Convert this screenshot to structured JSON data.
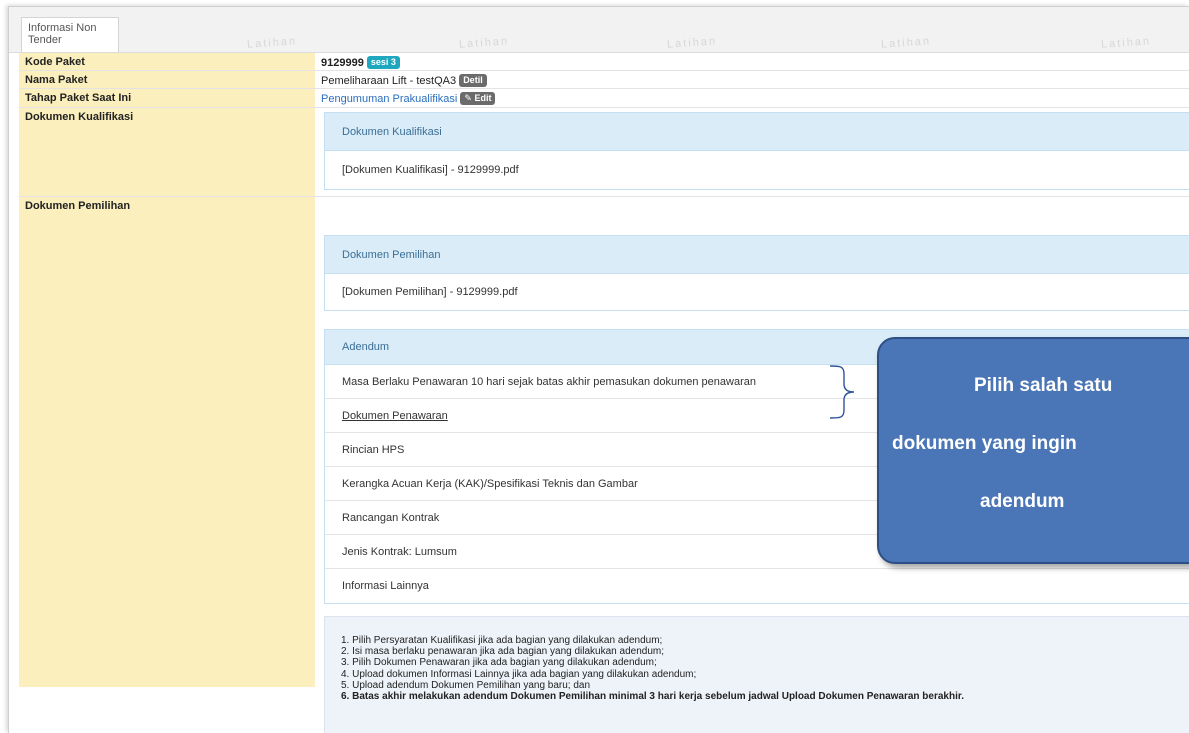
{
  "tab": {
    "label": "Informasi Non Tender"
  },
  "watermark": "Latihan",
  "rows": {
    "kode_paket": {
      "label": "Kode Paket",
      "value": "9129999",
      "badge": "sesi 3"
    },
    "nama_paket": {
      "label": "Nama Paket",
      "value": "Pemeliharaan Lift - testQA3",
      "badge": "Detil"
    },
    "tahap": {
      "label": "Tahap Paket Saat Ini",
      "value": "Pengumuman Prakualifikasi",
      "badge": "Edit"
    },
    "dok_kualifikasi": {
      "label": "Dokumen Kualifikasi"
    },
    "dok_pemilihan": {
      "label": "Dokumen Pemilihan"
    }
  },
  "panel_kualifikasi": {
    "title": "Dokumen Kualifikasi",
    "file": "[Dokumen Kualifikasi] - 9129999.pdf"
  },
  "panel_pemilihan": {
    "title": "Dokumen Pemilihan",
    "file": "[Dokumen Pemilihan] - 9129999.pdf"
  },
  "panel_adendum": {
    "title": "Adendum",
    "items": [
      "Masa Berlaku Penawaran 10 hari sejak batas akhir pemasukan dokumen penawaran",
      "Dokumen Penawaran",
      "Rincian HPS",
      "Kerangka Acuan Kerja (KAK)/Spesifikasi Teknis dan Gambar",
      "Rancangan Kontrak",
      "Jenis Kontrak: Lumsum",
      "Informasi Lainnya"
    ]
  },
  "notes": [
    "1. Pilih Persyaratan Kualifikasi jika ada bagian yang dilakukan adendum;",
    "2. Isi masa berlaku penawaran jika ada bagian yang dilakukan adendum;",
    "3. Pilih Dokumen Penawaran jika ada bagian yang dilakukan adendum;",
    "4. Upload dokumen Informasi Lainnya jika ada bagian yang dilakukan adendum;",
    "5. Upload adendum Dokumen Pemilihan yang baru; dan",
    "6. Batas akhir melakukan adendum Dokumen Pemilihan minimal 3 hari kerja sebelum jadwal Upload Dokumen Penawaran berakhir."
  ],
  "callout": {
    "line1": "Pilih salah satu",
    "line2": "dokumen yang ingin",
    "line3": "adendum"
  },
  "colors": {
    "label_bg": "#fbefbd",
    "panel_head": "#d9ecf8",
    "callout": "#4a75b6",
    "badge_teal": "#1fa7c0"
  }
}
